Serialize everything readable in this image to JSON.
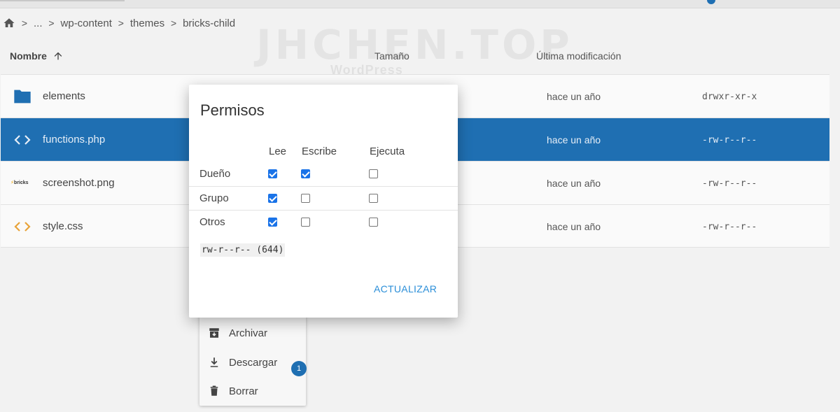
{
  "breadcrumb": [
    "...",
    "wp-content",
    "themes",
    "bricks-child"
  ],
  "watermark": {
    "main": "JHCHEN.TOP",
    "sub": "WordPress"
  },
  "columns": {
    "name": "Nombre",
    "size": "Tamaño",
    "modified": "Última modificación"
  },
  "files": [
    {
      "name": "elements",
      "icon": "folder-icon",
      "modified": "hace un año",
      "perms": "drwxr-xr-x"
    },
    {
      "name": "functions.php",
      "icon": "code-icon",
      "modified": "hace un año",
      "perms": "-rw-r--r--",
      "selected": true
    },
    {
      "name": "screenshot.png",
      "icon": "bricks-logo",
      "logo_text": "bricks",
      "modified": "hace un año",
      "perms": "-rw-r--r--"
    },
    {
      "name": "style.css",
      "icon": "code-icon",
      "modified": "hace un año",
      "perms": "-rw-r--r--"
    }
  ],
  "context_menu": {
    "archive": "Archivar",
    "download": "Descargar",
    "delete": "Borrar"
  },
  "badge_count": "1",
  "modal": {
    "title": "Permisos",
    "headers": {
      "read": "Lee",
      "write": "Escribe",
      "execute": "Ejecuta"
    },
    "rows": [
      {
        "label": "Dueño",
        "read": true,
        "write": true,
        "execute": false
      },
      {
        "label": "Grupo",
        "read": true,
        "write": false,
        "execute": false
      },
      {
        "label": "Otros",
        "read": true,
        "write": false,
        "execute": false
      }
    ],
    "code": "rw-r--r-- (644)",
    "button": "ACTUALIZAR"
  },
  "colors": {
    "accent": "#1f6fb2",
    "folder": "#1f6fb2",
    "code_icon": "#e8a33a",
    "button": "#2a8ed8"
  }
}
